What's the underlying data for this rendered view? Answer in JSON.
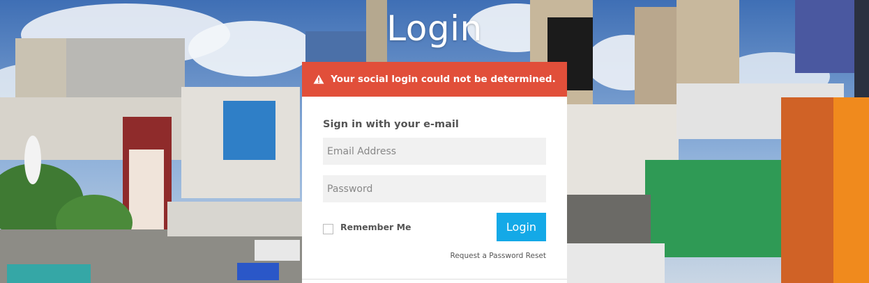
{
  "page": {
    "title": "Login"
  },
  "alert": {
    "message": "Your social login could not be determined.",
    "icon": "warning-icon",
    "color": "#e14f3a"
  },
  "form": {
    "heading": "Sign in with your e-mail",
    "email": {
      "value": "",
      "placeholder": "Email Address"
    },
    "password": {
      "value": "",
      "placeholder": "Password"
    },
    "remember_label": "Remember Me",
    "remember_checked": false,
    "login_label": "Login",
    "reset_label": "Request a Password Reset"
  },
  "colors": {
    "accent": "#14a9e7",
    "alert": "#e14f3a"
  }
}
